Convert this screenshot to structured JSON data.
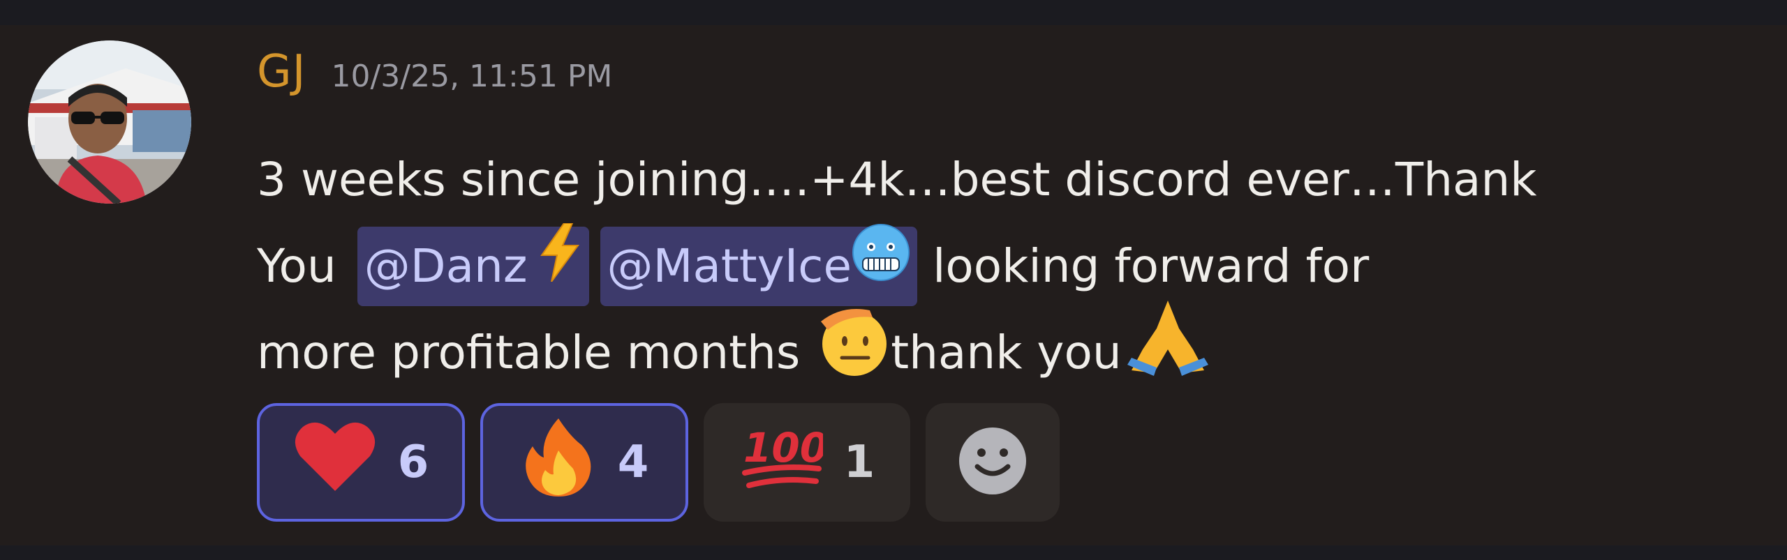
{
  "message": {
    "author": "GJ",
    "timestamp": "10/3/25, 11:51 PM",
    "author_color": "#d4952c",
    "line1": "3 weeks since joining.…+4k…best discord ever…Thank",
    "line2_prefix": "You",
    "mention1": "@Danz",
    "mention1_emoji": "high-voltage-emoji",
    "mention2": "@MattyIce",
    "mention2_emoji": "cold-face-emoji",
    "line2_suffix": "looking forward for",
    "line3_text": "more profitable months",
    "saluting_emoji": "saluting-face-emoji",
    "line3_thanks": "thank you",
    "folded_hands_emoji": "folded-hands-emoji"
  },
  "reactions": [
    {
      "emoji": "red-heart-emoji",
      "count": "6",
      "active": true
    },
    {
      "emoji": "fire-emoji",
      "count": "4",
      "active": true
    },
    {
      "emoji": "hundred-points-emoji",
      "count": "1",
      "active": false
    }
  ],
  "add_reaction_icon": "add-reaction-smiley-icon",
  "colors": {
    "mention_bg": "#3d3a6b",
    "mention_text": "#c8cbfa",
    "active_reaction_border": "#5d64e0",
    "message_bg": "#221d1c"
  }
}
